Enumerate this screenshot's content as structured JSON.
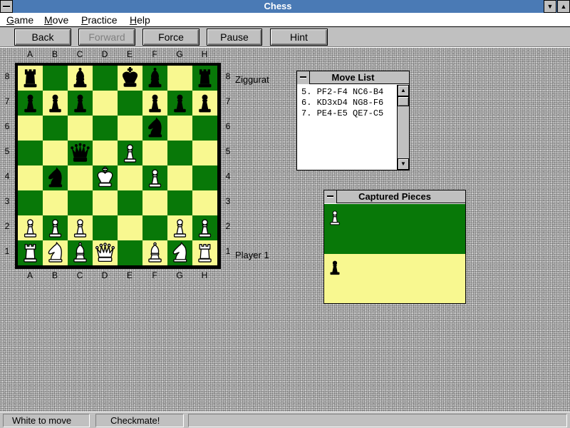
{
  "window": {
    "title": "Chess"
  },
  "menu": [
    {
      "label": "Game",
      "underline": "G",
      "rest": "ame"
    },
    {
      "label": "Move",
      "underline": "M",
      "rest": "ove"
    },
    {
      "label": "Practice",
      "underline": "P",
      "rest": "ractice"
    },
    {
      "label": "Help",
      "underline": "H",
      "rest": "elp"
    }
  ],
  "toolbar": {
    "back": "Back",
    "forward": "Forward",
    "force": "Force",
    "pause": "Pause",
    "hint": "Hint"
  },
  "board": {
    "files": [
      "A",
      "B",
      "C",
      "D",
      "E",
      "F",
      "G",
      "H"
    ],
    "ranks": [
      "8",
      "7",
      "6",
      "5",
      "4",
      "3",
      "2",
      "1"
    ],
    "colors": {
      "light": "#f8f890",
      "dark": "#087808"
    },
    "position": [
      "r.b.kb.r",
      "ppp..ppp",
      ".....n..",
      "..q.P...",
      ".n.K.P..",
      "........",
      "PPP...PP",
      "RNBQ.BNR"
    ],
    "top_player": "Ziggurat",
    "bottom_player": "Player 1"
  },
  "move_list": {
    "title": "Move List",
    "moves": [
      "5. PF2-F4 NC6-B4",
      "6. KD3xD4 NG8-F6",
      "7. PE4-E5 QE7-C5"
    ]
  },
  "captured": {
    "title": "Captured Pieces",
    "white_pieces": [
      "white-pawn"
    ],
    "black_pieces": [
      "black-pawn"
    ]
  },
  "status": {
    "turn": "White to move",
    "state": "Checkmate!",
    "message": ""
  }
}
